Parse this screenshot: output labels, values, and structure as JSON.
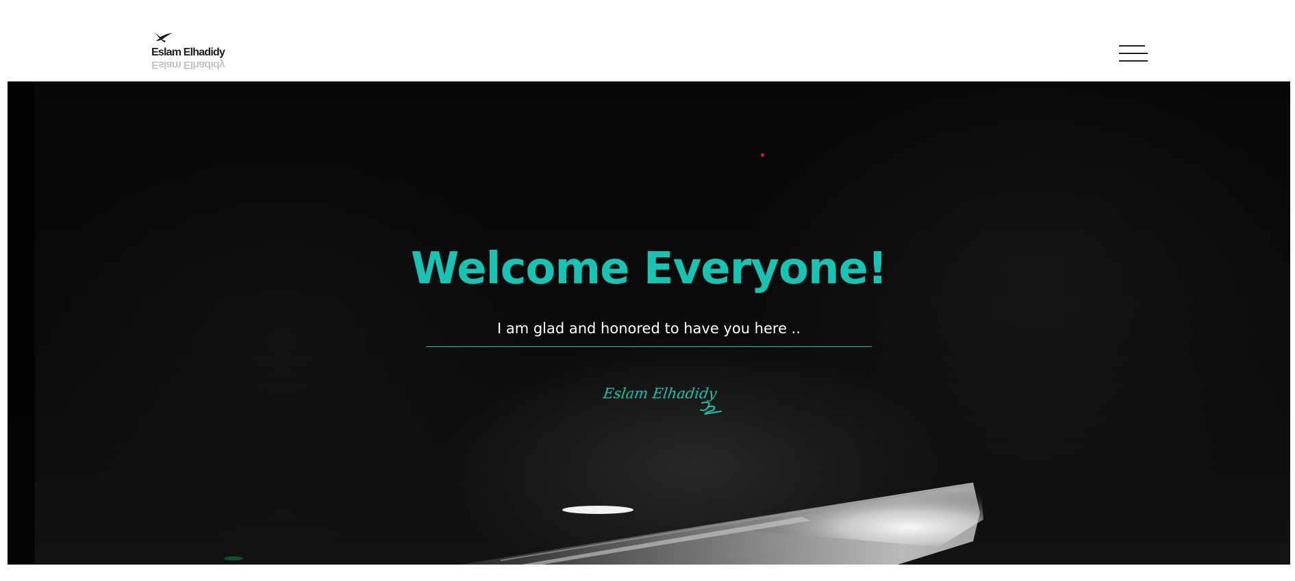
{
  "header": {
    "logo_text": "Eslam Elhadidy",
    "logo_icon": "bird-icon",
    "menu_icon": "hamburger-menu-icon"
  },
  "hero": {
    "title": "Welcome Everyone!",
    "subtitle": "I am glad and honored to have you here ..",
    "signature": "Eslam Elhadidy"
  },
  "colors": {
    "accent": "#17c3b2",
    "background": "#ffffff",
    "hero_background": "#0b0b0c",
    "dot": "#e02020"
  }
}
